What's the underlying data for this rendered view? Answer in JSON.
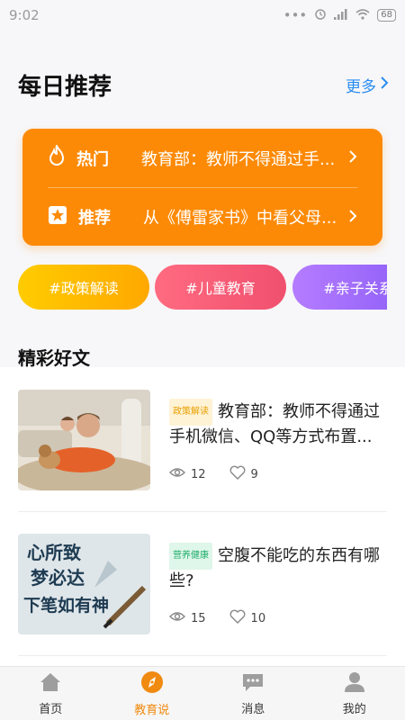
{
  "status": {
    "time": "9:02",
    "battery": "68"
  },
  "header": {
    "title": "每日推荐",
    "more_label": "更多"
  },
  "featured": [
    {
      "tag": "热门",
      "icon": "flame-icon",
      "text": "教育部：教师不得通过手..."
    },
    {
      "tag": "推荐",
      "icon": "star-icon",
      "text": "从《傅雷家书》中看父母..."
    }
  ],
  "chips": [
    {
      "label": "#政策解读",
      "color_from": "#ffcc00",
      "color_to": "#ffa800"
    },
    {
      "label": "#儿童教育",
      "color_from": "#ff6b81",
      "color_to": "#f0506e"
    },
    {
      "label": "#亲子关系",
      "color_from": "#b57cff",
      "color_to": "#8a5cf6"
    }
  ],
  "section_title": "精彩好文",
  "articles": [
    {
      "category": "政策解读",
      "category_color": "#e8a000",
      "category_bg": "#fff3d6",
      "title": "教育部：教师不得通过手机微信、QQ等方式布置...",
      "views": "12",
      "likes": "9",
      "thumb": "family-photo"
    },
    {
      "category": "营养健康",
      "category_color": "#1fae6a",
      "category_bg": "#dff6ea",
      "title": "空腹不能吃的东西有哪些?",
      "views": "15",
      "likes": "10",
      "thumb": "calligraphy",
      "thumb_text": [
        "心所致",
        "梦必达",
        "下笔如有神"
      ]
    }
  ],
  "tabs": [
    {
      "label": "首页",
      "icon": "home-icon",
      "active": false
    },
    {
      "label": "教育说",
      "icon": "compass-icon",
      "active": true
    },
    {
      "label": "消息",
      "icon": "message-icon",
      "active": false
    },
    {
      "label": "我的",
      "icon": "user-icon",
      "active": false
    }
  ],
  "colors": {
    "accent": "#fd8a06",
    "link": "#2a8df0",
    "active_tab": "#f08a10"
  }
}
